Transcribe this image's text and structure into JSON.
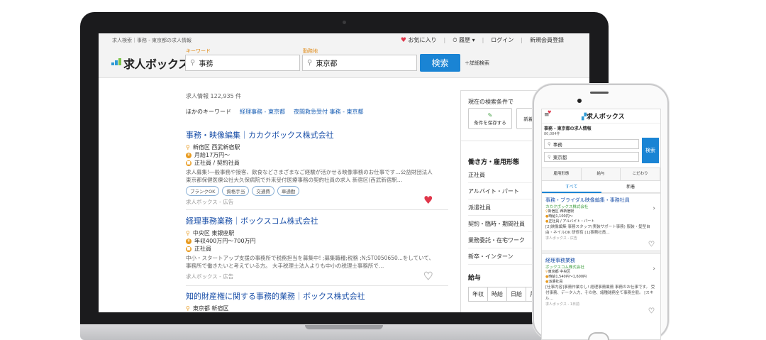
{
  "laptop": {
    "breadcrumb": "求人検索｜事務 - 東京都の求人情報",
    "topnav": {
      "favorites": "お気に入り",
      "history": "履歴",
      "login": "ログイン",
      "register": "新規会員登録"
    },
    "logo_text": "求人ボックス",
    "search": {
      "keyword_label": "キーワード",
      "keyword_value": "事務",
      "location_label": "勤務地",
      "location_value": "東京都",
      "button": "検索",
      "detail_link": "＋詳細検索"
    },
    "result_count": "求人情報 122,935 件",
    "other_keywords": {
      "label": "ほかのキーワード",
      "items": [
        "経理事務 - 東京都",
        "夜間救急受付 事務 - 東京都"
      ]
    },
    "jobs": [
      {
        "title": "事務・映像編集｜カカクボックス株式会社",
        "location": "新宿区 西武新宿駅",
        "salary": "月給17万円〜",
        "employment": "正社員 / 契約社員",
        "desc": "求人募集!―般事務や接客、飲食などさまざまなご経験が活かせる映像事務のお仕事です…公益財団法人東京都保健医療公社大久保病院で外来受付医療事務の契約社員の求人 新宿区(西武新宿駅…",
        "tags": [
          "ブランクOK",
          "資格手当",
          "交通費",
          "車通勤"
        ],
        "source": "求人ボックス - 広告"
      },
      {
        "title": "経理事務業務｜ボックスコム株式会社",
        "location": "中央区 東銀座駅",
        "salary": "年収400万円〜700万円",
        "employment": "正社員",
        "desc": "中小・スタートアップ支援の事務所で税務担当を募集中! ;募集職種;税務 ;N;ST0050650...をしていて、事務所で働きたいと考えている方。 大手税理士法人よりも中小の税理士事務所で…",
        "tags": [],
        "source": "求人ボックス - 広告"
      },
      {
        "title": "知的財産権に関する事務的業務｜ボックス株式会社",
        "location": "東京都 新宿区"
      }
    ],
    "right_panel": {
      "current_conditions": "現在の検索条件で",
      "save_condition": "条件を保存する",
      "new_label": "新着メ",
      "employment_heading": "働き方・雇用形態",
      "employment_items": [
        "正社員",
        "アルバイト・パート",
        "派遣社員",
        "契約・臨時・期間社員",
        "業務委託・在宅ワーク",
        "新卒・インターン"
      ],
      "salary_heading": "給与",
      "salary_tabs": [
        "年収",
        "時給",
        "日給",
        "月"
      ]
    }
  },
  "phone": {
    "logo_text": "求人ボックス",
    "breadcrumb": "事務 - 東京都の求人情報",
    "count": "80,084件",
    "keyword_value": "事務",
    "location_value": "東京都",
    "button": "検索",
    "filters": [
      "雇用形態",
      "給与",
      "こだわり"
    ],
    "tabs": [
      "すべて",
      "新着"
    ],
    "cards": [
      {
        "title": "事務・ブライダル映像編集・事務社員",
        "company": "カカクボックス株式会社",
        "location": "新宿区 西新宿駅",
        "salary": "時給1,100円〜",
        "employment": "正社員 / アルバイト・パート",
        "desc": "[2]映像編集 事務スタッフ(実装サポート事務) 服装・髪型自由・ネイルOK 研修有 [1]事務社員…",
        "source": "求人ボックス - 広告"
      },
      {
        "title": "経理事務業務",
        "company": "ボックスコム株式会社",
        "location": "東京都 中央区",
        "salary": "時給1,540円〜1,600円",
        "employment": "派遣社員",
        "desc": "[仕事内容]事務作業なし! 経理事務業務 事務のお仕事です。 受付事務、データ入力、その他、諸種雑務全て事務全般。 [スキル…",
        "source": "求人ボックス - 1日前"
      }
    ]
  },
  "colors": {
    "accent": "#1a84d4",
    "favorite": "#e0364a",
    "link": "#1a4fa8"
  }
}
